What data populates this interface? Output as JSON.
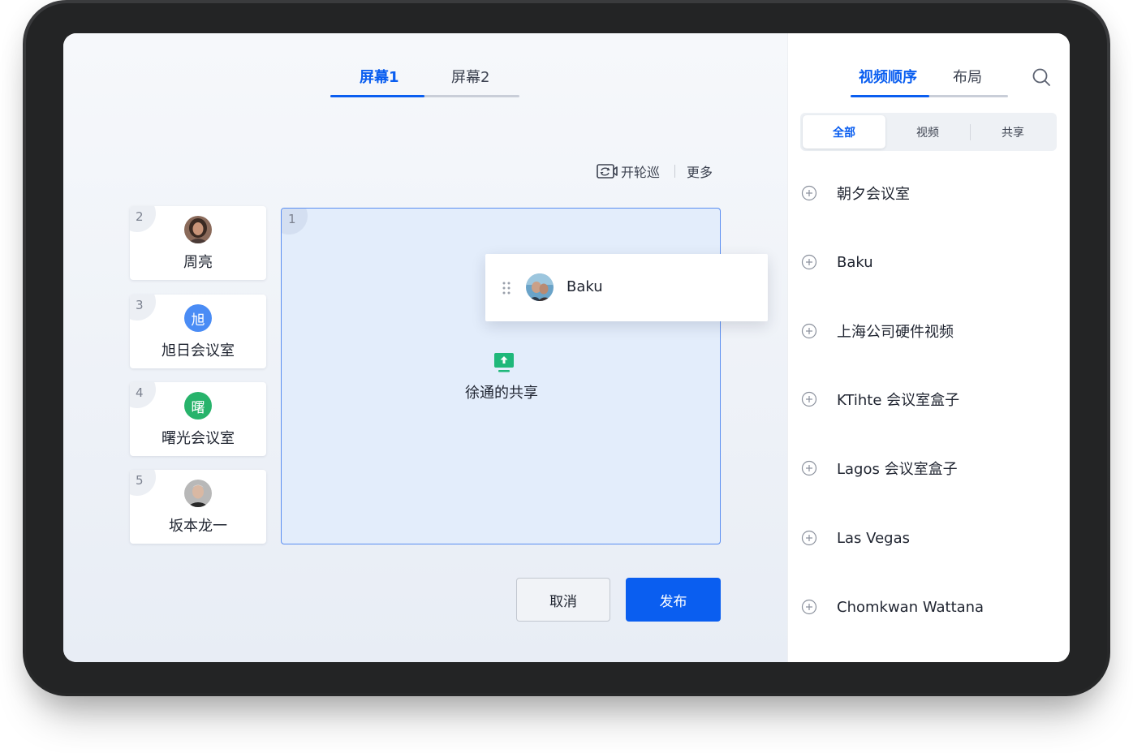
{
  "left": {
    "tabs": [
      {
        "label": "屏幕1",
        "active": true
      },
      {
        "label": "屏幕2",
        "active": false
      }
    ],
    "toolbar": {
      "rotate_label": "开轮巡",
      "more_label": "更多"
    },
    "tiles": [
      {
        "number": "2",
        "name": "周亮",
        "avatar_type": "photo",
        "avatar_text": ""
      },
      {
        "number": "3",
        "name": "旭日会议室",
        "avatar_type": "text",
        "avatar_text": "旭",
        "avatar_color": "#4a8cf5"
      },
      {
        "number": "4",
        "name": "曙光会议室",
        "avatar_type": "text",
        "avatar_text": "曙",
        "avatar_color": "#27b36b"
      },
      {
        "number": "5",
        "name": "坂本龙一",
        "avatar_type": "photo",
        "avatar_text": ""
      }
    ],
    "main": {
      "number": "1",
      "share_label": "徐通的共享"
    },
    "drag_item": {
      "name": "Baku"
    },
    "buttons": {
      "cancel": "取消",
      "publish": "发布"
    }
  },
  "right": {
    "tabs": [
      {
        "label": "视频顺序",
        "active": true
      },
      {
        "label": "布局",
        "active": false
      }
    ],
    "filters": [
      {
        "label": "全部",
        "active": true
      },
      {
        "label": "视频",
        "active": false
      },
      {
        "label": "共享",
        "active": false
      }
    ],
    "list": [
      "朝夕会议室",
      "Baku",
      "上海公司硬件视频",
      "KTihte 会议室盒子",
      "Lagos 会议室盒子",
      "Las Vegas",
      "Chomkwan Wattana"
    ]
  },
  "colors": {
    "accent": "#0a5ef0",
    "share_icon": "#1fb87a"
  }
}
